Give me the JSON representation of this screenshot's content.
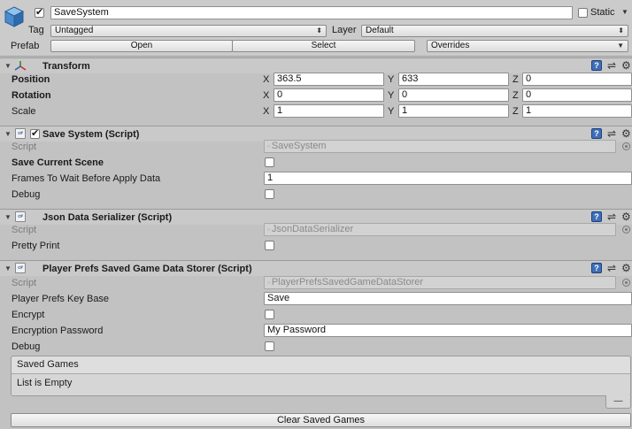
{
  "gameobject": {
    "name": "SaveSystem",
    "active": true,
    "static_label": "Static",
    "tag_label": "Tag",
    "tag_value": "Untagged",
    "layer_label": "Layer",
    "layer_value": "Default",
    "prefab_label": "Prefab",
    "prefab_open": "Open",
    "prefab_select": "Select",
    "prefab_overrides": "Overrides"
  },
  "transform": {
    "title": "Transform",
    "rows": [
      {
        "label": "Position",
        "x": "363.5",
        "y": "633",
        "z": "0"
      },
      {
        "label": "Rotation",
        "x": "0",
        "y": "0",
        "z": "0"
      },
      {
        "label": "Scale",
        "x": "1",
        "y": "1",
        "z": "1"
      }
    ],
    "axis_x": "X",
    "axis_y": "Y",
    "axis_z": "Z"
  },
  "save_system": {
    "title": "Save System (Script)",
    "script_label": "Script",
    "script_value": "SaveSystem",
    "save_current_scene_label": "Save Current Scene",
    "frames_label": "Frames To Wait Before Apply Data",
    "frames_value": "1",
    "debug_label": "Debug"
  },
  "json_serializer": {
    "title": "Json Data Serializer (Script)",
    "script_label": "Script",
    "script_value": "JsonDataSerializer",
    "pretty_print_label": "Pretty Print"
  },
  "player_prefs": {
    "title": "Player Prefs Saved Game Data Storer (Script)",
    "script_label": "Script",
    "script_value": "PlayerPrefsSavedGameDataStorer",
    "key_base_label": "Player Prefs Key Base",
    "key_base_value": "Save",
    "encrypt_label": "Encrypt",
    "password_label": "Encryption Password",
    "password_value": "My Password",
    "debug_label": "Debug",
    "saved_games_header": "Saved Games",
    "list_empty": "List is Empty",
    "remove_symbol": "—",
    "clear_button": "Clear Saved Games"
  },
  "icons": {
    "help": "?",
    "script_glyph": "c#",
    "foldout_open": "▼",
    "dropdown_arrow": "⬍"
  }
}
